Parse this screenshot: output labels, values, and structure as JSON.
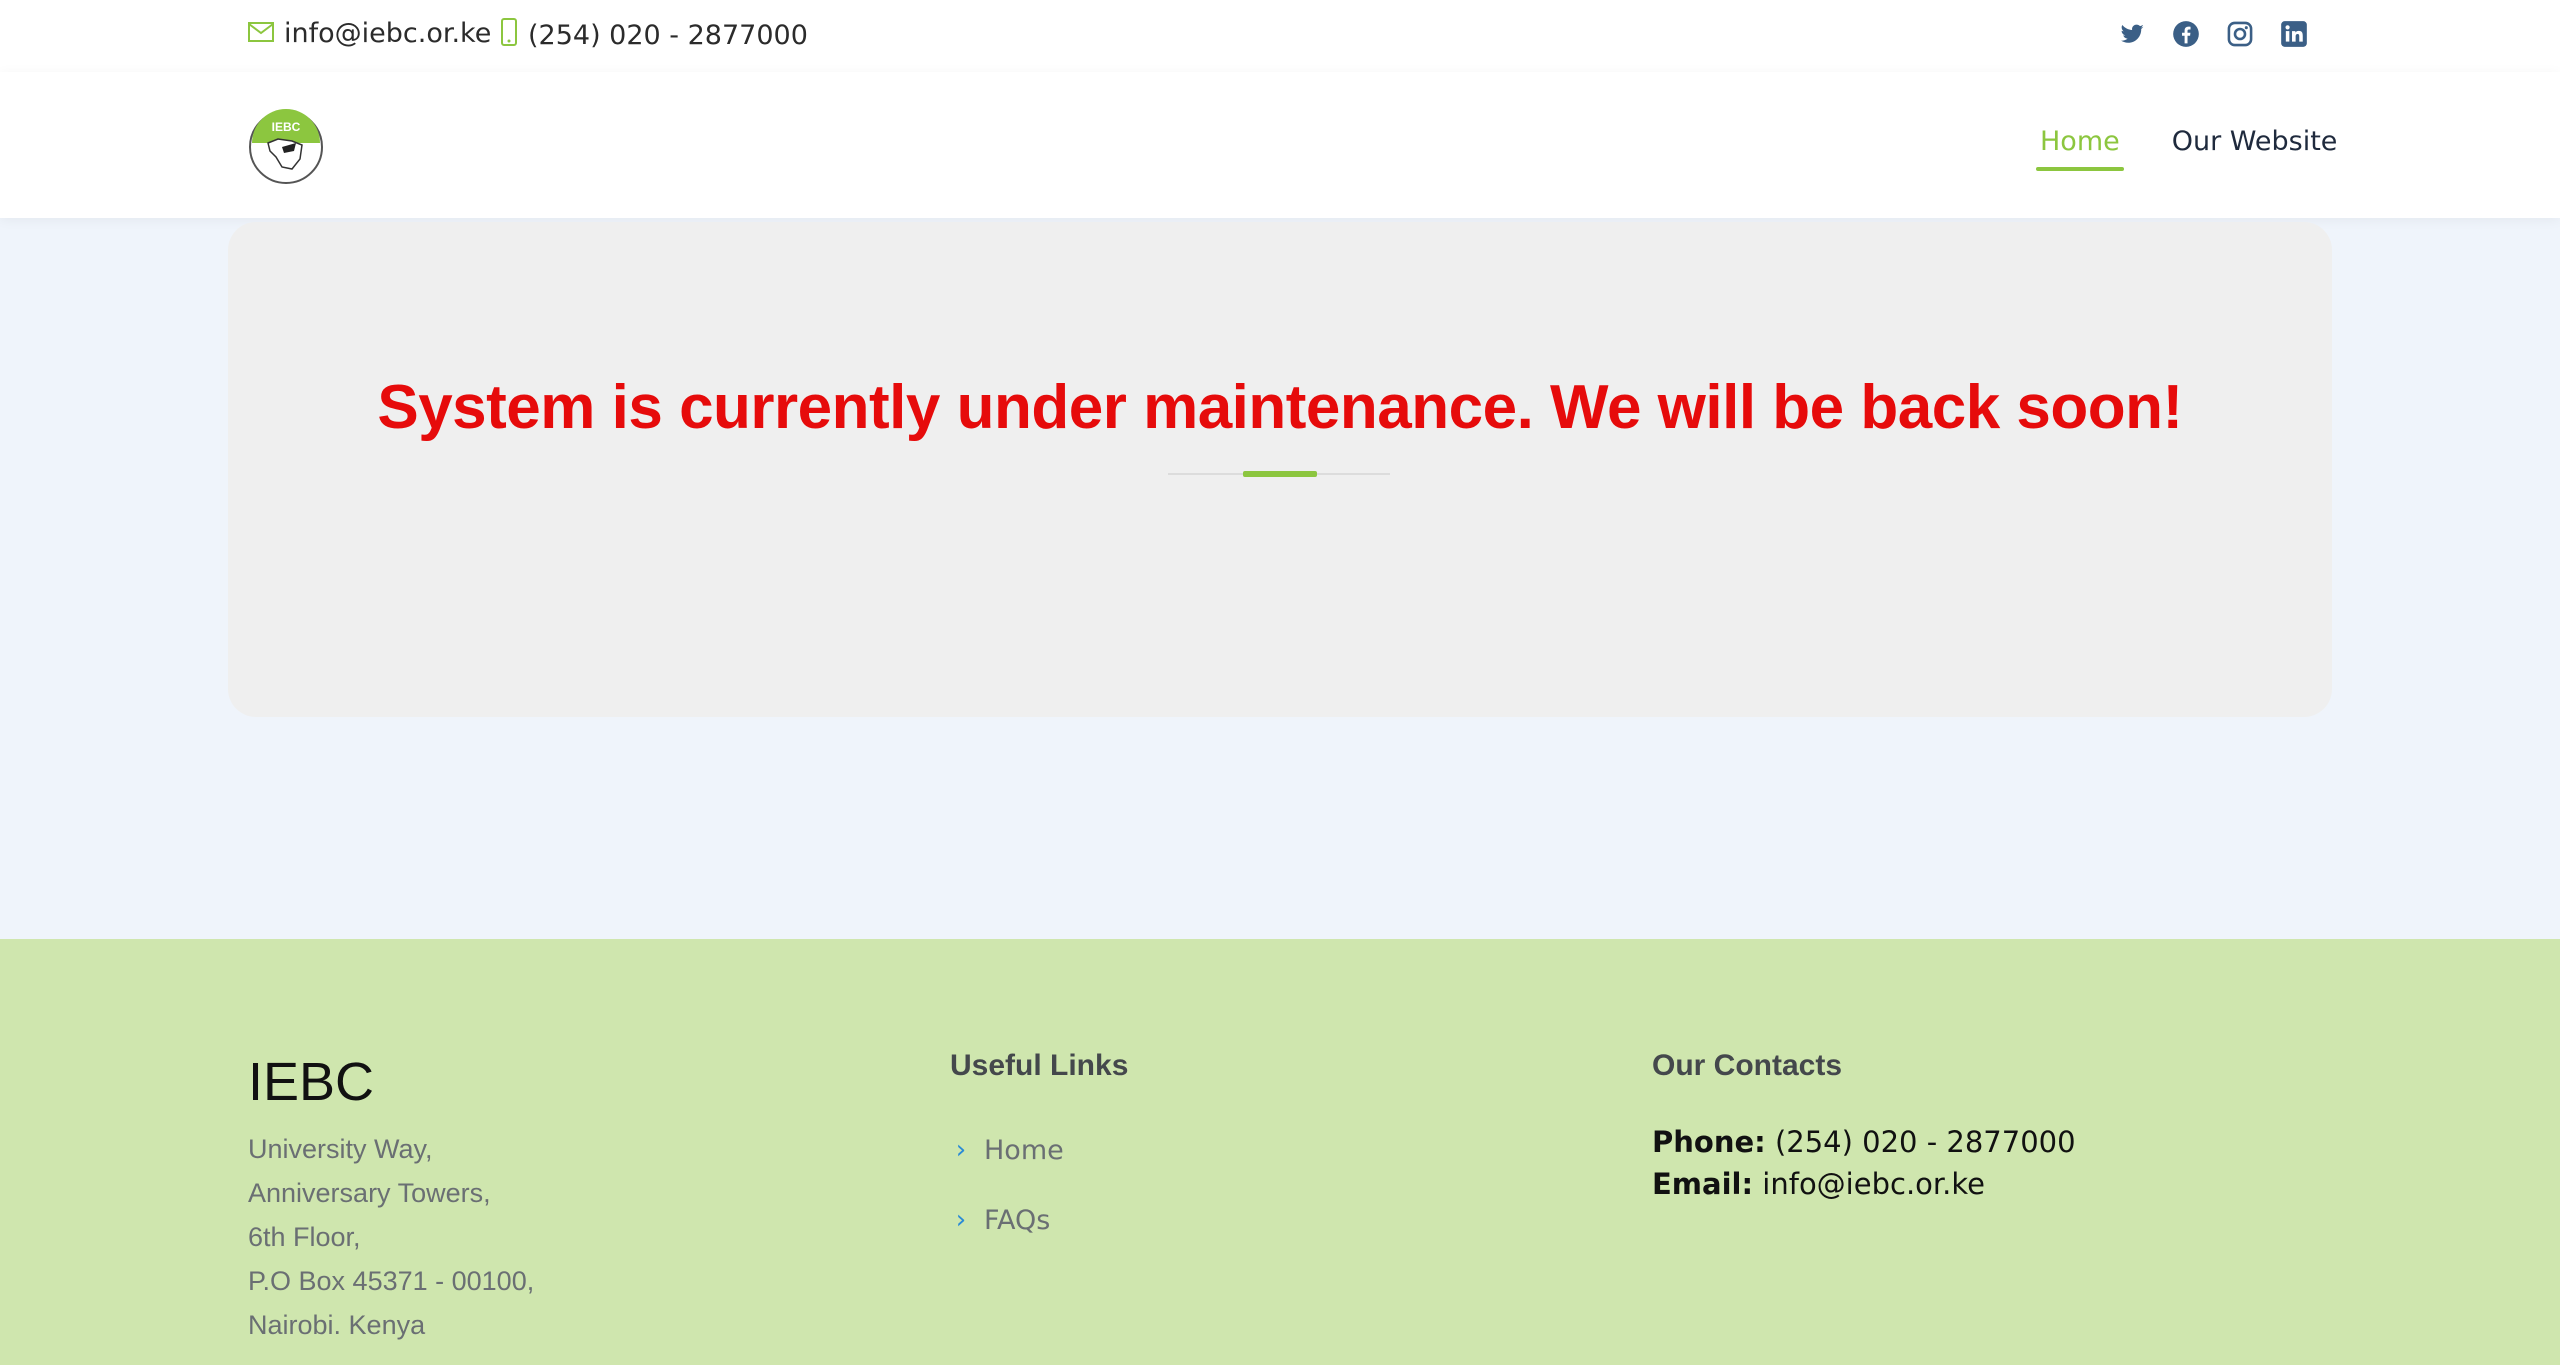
{
  "topbar": {
    "email": "info@iebc.or.ke",
    "phone": "(254) 020 - 2877000",
    "social_icons": [
      "twitter-icon",
      "facebook-icon",
      "instagram-icon",
      "linkedin-icon"
    ]
  },
  "header": {
    "logo_text": "IEBC",
    "nav": [
      {
        "label": "Home",
        "active": true
      },
      {
        "label": "Our Website",
        "active": false
      }
    ]
  },
  "main": {
    "message": "System is currently under maintenance. We will be back soon!"
  },
  "footer": {
    "brand": "IEBC",
    "address": [
      "University Way,",
      "Anniversary Towers,",
      "6th Floor,",
      "P.O Box 45371 - 00100,",
      "Nairobi. Kenya"
    ],
    "useful_links": {
      "title": "Useful Links",
      "items": [
        "Home",
        "FAQs"
      ]
    },
    "contacts": {
      "title": "Our Contacts",
      "phone_label": "Phone:",
      "phone": "(254) 020 - 2877000",
      "email_label": "Email:",
      "email": "info@iebc.or.ke"
    }
  },
  "colors": {
    "accent": "#8cc63f",
    "alert": "#e60b0b",
    "footer_bg": "#cfe6ae",
    "social": "#3b5f86"
  }
}
